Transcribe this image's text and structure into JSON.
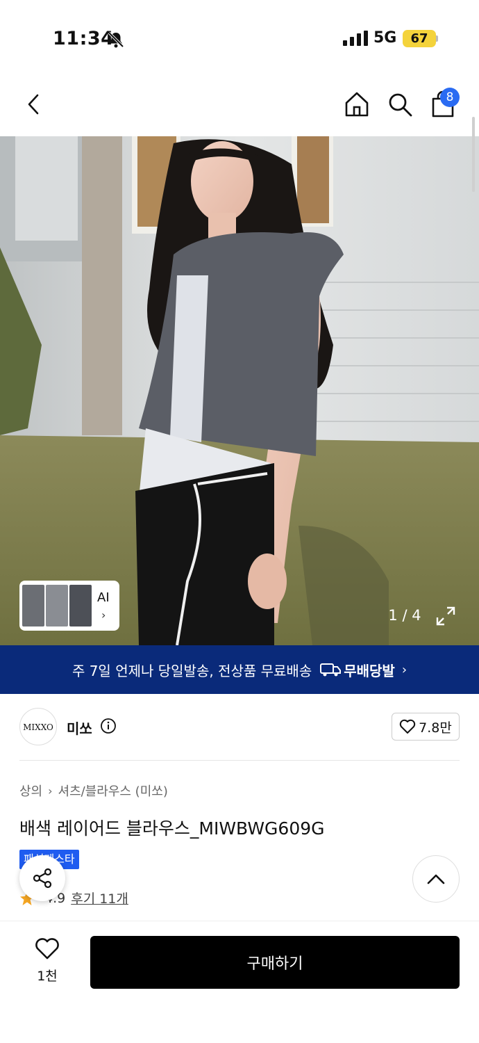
{
  "status": {
    "time": "11:34",
    "network": "5G",
    "battery": "67"
  },
  "nav": {
    "cart_count": "8"
  },
  "gallery": {
    "ai_label": "AI",
    "ai_chevron": "›",
    "pager": "1 / 4"
  },
  "promo": {
    "text": "주 7일 언제나 당일발송, 전상품 무료배송",
    "logo_text": "무배당발",
    "chevron": "›"
  },
  "brand": {
    "logo_text": "MIXXO",
    "name": "미쏘",
    "likes": "7.8만"
  },
  "product": {
    "breadcrumb": [
      "상의",
      "셔츠/블라우스 (미쏘)"
    ],
    "breadcrumb_sep": "›",
    "title": "배색 레이어드 블라우스_MIWBWG609G",
    "badge": "패션페스타",
    "rating": "4.9",
    "reviews_link": "후기 11개"
  },
  "bottom": {
    "wish_count": "1천",
    "buy_label": "구매하기"
  },
  "colors": {
    "promo_bg": "#0a2a7a",
    "badge_bg": "#1f5cf0",
    "cart_badge": "#2a6bf2",
    "star": "#f5a623"
  }
}
